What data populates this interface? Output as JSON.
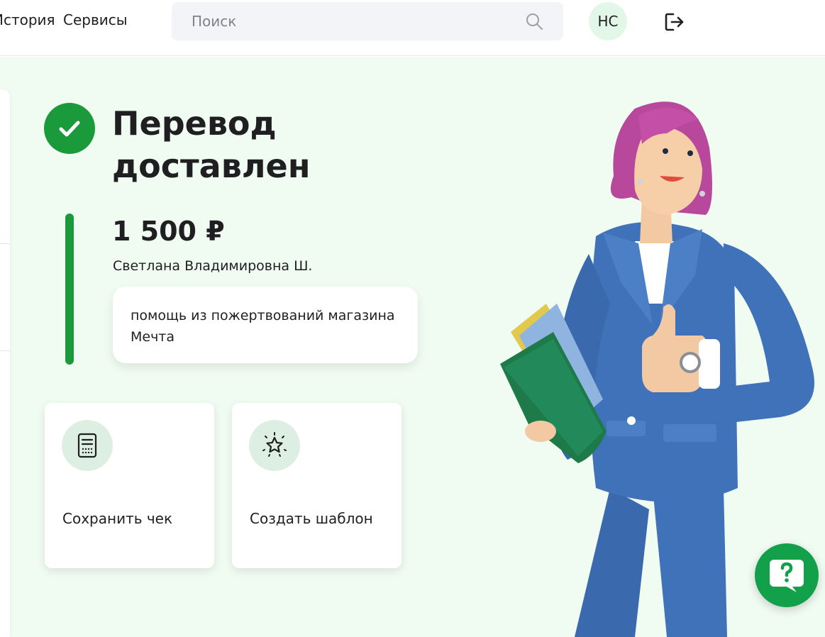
{
  "header": {
    "nav": {
      "history": "История",
      "services": "Сервисы"
    },
    "search": {
      "placeholder": "Поиск"
    },
    "avatar_initials": "НС"
  },
  "transfer": {
    "status_title": "Перевод доставлен",
    "amount": "1 500 ₽",
    "recipient": "Светлана Владимировна Ш.",
    "message": "помощь из пожертвований магазина Мечта"
  },
  "actions": [
    {
      "label": "Сохранить чек",
      "icon": "receipt-icon"
    },
    {
      "label": "Создать шаблон",
      "icon": "star-icon"
    }
  ],
  "colors": {
    "accent": "#1a9a3a",
    "help_button": "#12a14a",
    "background": "#f0fbf2",
    "icon_circle": "#ddefe2"
  }
}
